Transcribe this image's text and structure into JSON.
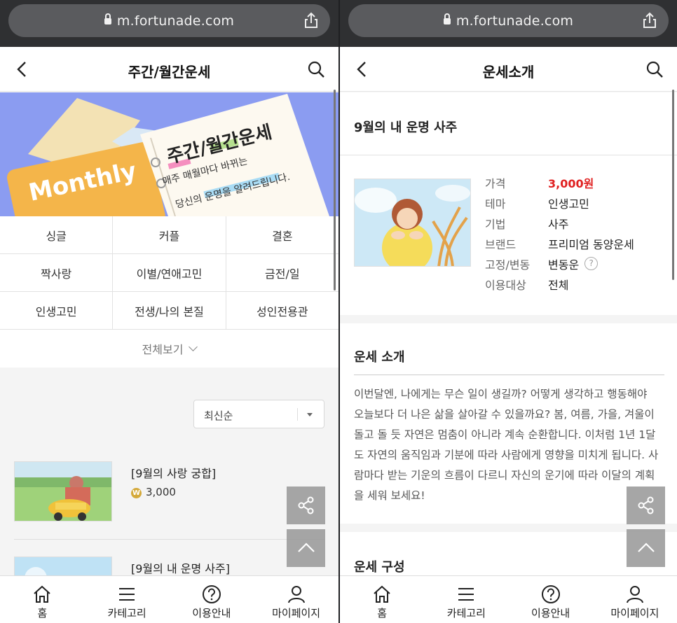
{
  "browser": {
    "url": "m.fortunade.com"
  },
  "left": {
    "header": {
      "title": "주간/월간운세"
    },
    "banner": {
      "tag": "Monthly",
      "title": "주간/월간운세",
      "line1": "매주 매월마다 바뀌는",
      "line2": "당신의 운명을 알려드립니다."
    },
    "categories": [
      [
        "싱글",
        "커플",
        "결혼"
      ],
      [
        "짝사랑",
        "이별/연애고민",
        "금전/일"
      ],
      [
        "인생고민",
        "전생/나의 본질",
        "성인전용관"
      ]
    ],
    "view_all": "전체보기",
    "sort": {
      "selected": "최신순"
    },
    "products": [
      {
        "title": "[9월의 사랑 궁합]",
        "price": "3,000",
        "coin": "W"
      },
      {
        "title": "[9월의 내 운명 사주]"
      }
    ]
  },
  "right": {
    "header": {
      "title": "운세소개"
    },
    "product_name": "9월의 내 운명 사주",
    "info": [
      {
        "key": "가격",
        "value": "3,000원"
      },
      {
        "key": "테마",
        "value": "인생고민"
      },
      {
        "key": "기법",
        "value": "사주"
      },
      {
        "key": "브랜드",
        "value": "프리미엄 동양운세"
      },
      {
        "key": "고정/변동",
        "value": "변동운",
        "help": "?"
      },
      {
        "key": "이용대상",
        "value": "전체"
      }
    ],
    "intro_title": "운세 소개",
    "intro_lines": [
      "이번달엔, 나에게는 무슨 일이 생길까? 어떻게 생각하고 행동해야",
      "오늘보다 더 나은 삶을 살아갈 수 있을까요? 봄, 여름, 가을, 겨울이",
      "돌고 돌 듯 자연은 멈춤이 아니라 계속 순환합니다. 이처럼 1년 1달",
      "도 자연의 움직임과 기분에 따라 사람에게 영향을 미치게 됩니다. 사",
      "람마다 받는 기운의 흐름이 다르니 자신의 운기에 따라 이달의 계획",
      "을 세워 보세요!"
    ],
    "composition_title": "운세 구성"
  },
  "nav": [
    {
      "label": "홈",
      "icon": "home-icon"
    },
    {
      "label": "카테고리",
      "icon": "menu-icon"
    },
    {
      "label": "이용안내",
      "icon": "help-icon"
    },
    {
      "label": "마이페이지",
      "icon": "user-icon"
    }
  ],
  "colors": {
    "price": "#e02020",
    "banner_bg": "#8b9cf1",
    "coin": "#d4a93a"
  }
}
